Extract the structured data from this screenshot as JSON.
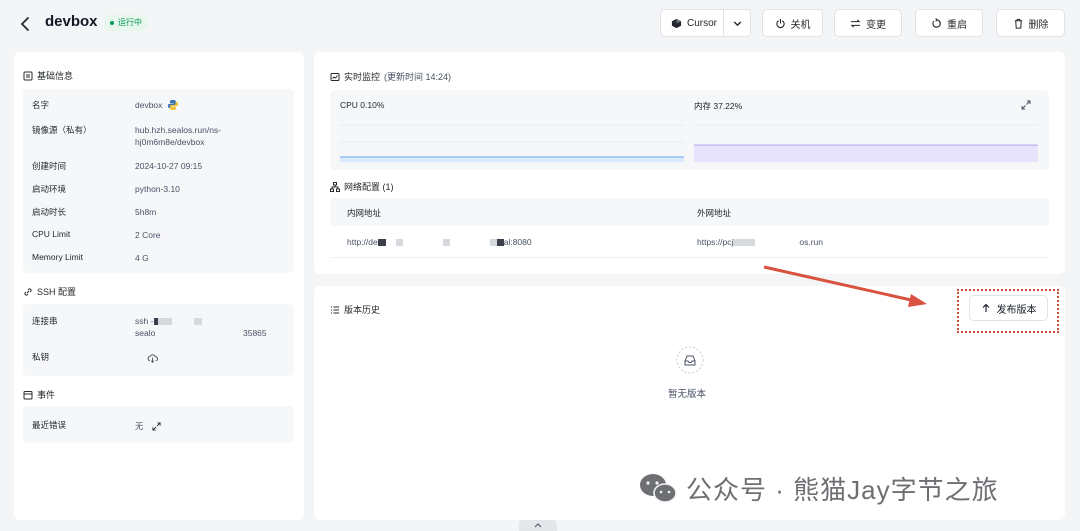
{
  "header": {
    "title": "devbox",
    "status": "运行中",
    "ide_label": "Cursor",
    "shutdown_label": "关机",
    "change_label": "变更",
    "restart_label": "重启",
    "delete_label": "删除"
  },
  "basic": {
    "title": "基础信息",
    "rows": [
      {
        "label": "名字",
        "value": "devbox"
      },
      {
        "label": "镜像源（私有）",
        "value_line1": "hub.hzh.sealos.run/ns-",
        "value_line2": "hj0m6m8e/devbox"
      },
      {
        "label": "创建时间",
        "value": "2024-10-27 09:15"
      },
      {
        "label": "启动环境",
        "value": "python-3.10"
      },
      {
        "label": "启动时长",
        "value": "5h8m"
      },
      {
        "label": "CPU Limit",
        "value": "2 Core"
      },
      {
        "label": "Memory Limit",
        "value": "4 G"
      }
    ]
  },
  "ssh": {
    "title": "SSH 配置",
    "conn_label": "连接串",
    "conn_line1": "ssh -",
    "conn_line2": "sealo",
    "conn_port": "35865",
    "key_label": "私钥"
  },
  "events": {
    "title": "事件",
    "error_label": "最近错误",
    "error_value": "无"
  },
  "monitor": {
    "title": "实时监控",
    "updated": "(更新时间 14:24)",
    "cpu_label": "CPU 0.10%",
    "mem_label": "内存 37.22%",
    "cpu_percent": 0.1,
    "mem_percent": 37.22
  },
  "network": {
    "title": "网络配置 (1)",
    "col_internal": "内网地址",
    "col_external": "外网地址",
    "internal_prefix": "http://de",
    "internal_suffix": "al:8080",
    "external_prefix": "https://pcj",
    "external_suffix": "os.run"
  },
  "versions": {
    "title": "版本历史",
    "publish_label": "发布版本",
    "empty_label": "暂无版本"
  },
  "watermark": {
    "text": "公众号 · 熊猫Jay字节之旅"
  },
  "colors": {
    "accent_green": "#039855",
    "annotation_red": "#d9523f",
    "cpu_line": "#7fb9f0",
    "mem_fill": "#b9b4f2"
  }
}
